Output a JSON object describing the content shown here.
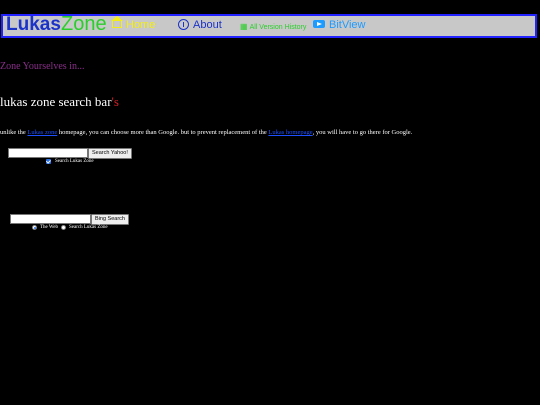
{
  "nav": {
    "logo_lukas": "Lukas",
    "logo_zone": "Zone",
    "home": "Home",
    "about": "About",
    "version_history": "All Version History",
    "bitview": "BitView"
  },
  "tagline": "Zone Yourselves in...",
  "heading": {
    "main": "lukas zone search bar",
    "suffix": "'s"
  },
  "intro": {
    "part1": "unlike the ",
    "link1": "Lukas zone",
    "part2": " homepage, you can choose more than Google. but to prevent replacement of the ",
    "link2": "Lukas homepage",
    "part3": ", you will have to go there for Google."
  },
  "yahoo": {
    "button": "Search Yahoo!",
    "checkbox_label": "Search Lukas Zone",
    "checkbox_checked": true
  },
  "bing": {
    "button": "Bing Search",
    "radio_web": "The Web",
    "radio_site": "Search Lukas Zone",
    "selected": "The Web"
  },
  "colors": {
    "nav_background": "#c8c8c8",
    "nav_border": "#2222ff",
    "lukas": "#1b33c9",
    "zone": "#2bcf2b",
    "home": "#f3ee1a",
    "bitview": "#1e9bff",
    "tagline": "#8a2e8a",
    "heading_suffix": "#d0202a"
  }
}
